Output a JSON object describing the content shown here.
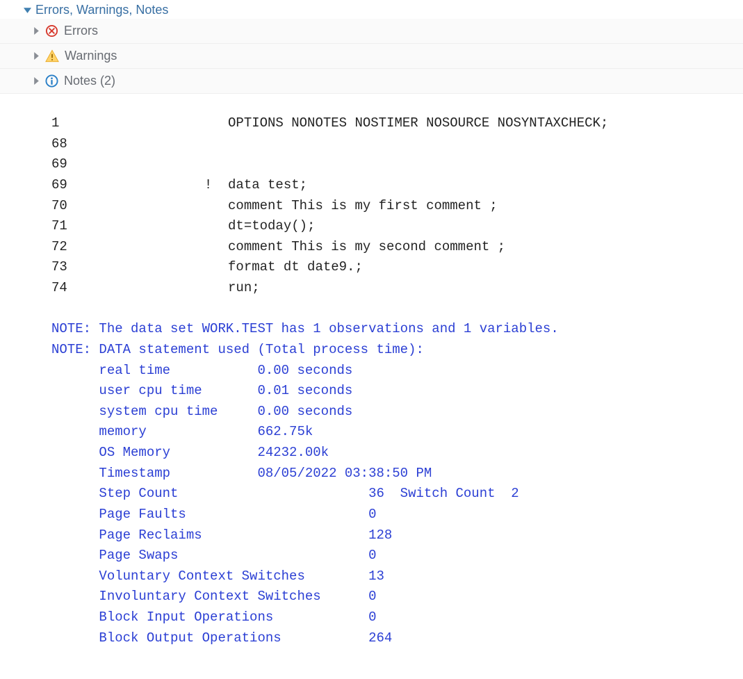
{
  "header": {
    "title": "Errors, Warnings, Notes"
  },
  "sections": {
    "errors": {
      "label": "Errors"
    },
    "warnings": {
      "label": "Warnings"
    },
    "notes": {
      "label": "Notes (2)"
    }
  },
  "log": {
    "lines": [
      {
        "n": "1",
        "t": "          OPTIONS NONOTES NOSTIMER NOSOURCE NOSYNTAXCHECK;"
      },
      {
        "n": "68",
        "t": "          "
      },
      {
        "n": "69",
        "t": "          "
      },
      {
        "n": "69",
        "t": "       !  data test;"
      },
      {
        "n": "70",
        "t": "          comment This is my first comment ;"
      },
      {
        "n": "71",
        "t": "          dt=today();"
      },
      {
        "n": "72",
        "t": "          comment This is my second comment ;"
      },
      {
        "n": "73",
        "t": "          format dt date9.;"
      },
      {
        "n": "74",
        "t": "          run;"
      }
    ],
    "notes": [
      "NOTE: The data set WORK.TEST has 1 observations and 1 variables.",
      "NOTE: DATA statement used (Total process time):",
      "      real time           0.00 seconds",
      "      user cpu time       0.01 seconds",
      "      system cpu time     0.00 seconds",
      "      memory              662.75k",
      "      OS Memory           24232.00k",
      "      Timestamp           08/05/2022 03:38:50 PM",
      "      Step Count                        36  Switch Count  2",
      "      Page Faults                       0",
      "      Page Reclaims                     128",
      "      Page Swaps                        0",
      "      Voluntary Context Switches        13",
      "      Involuntary Context Switches      0",
      "      Block Input Operations            0",
      "      Block Output Operations           264"
    ]
  }
}
